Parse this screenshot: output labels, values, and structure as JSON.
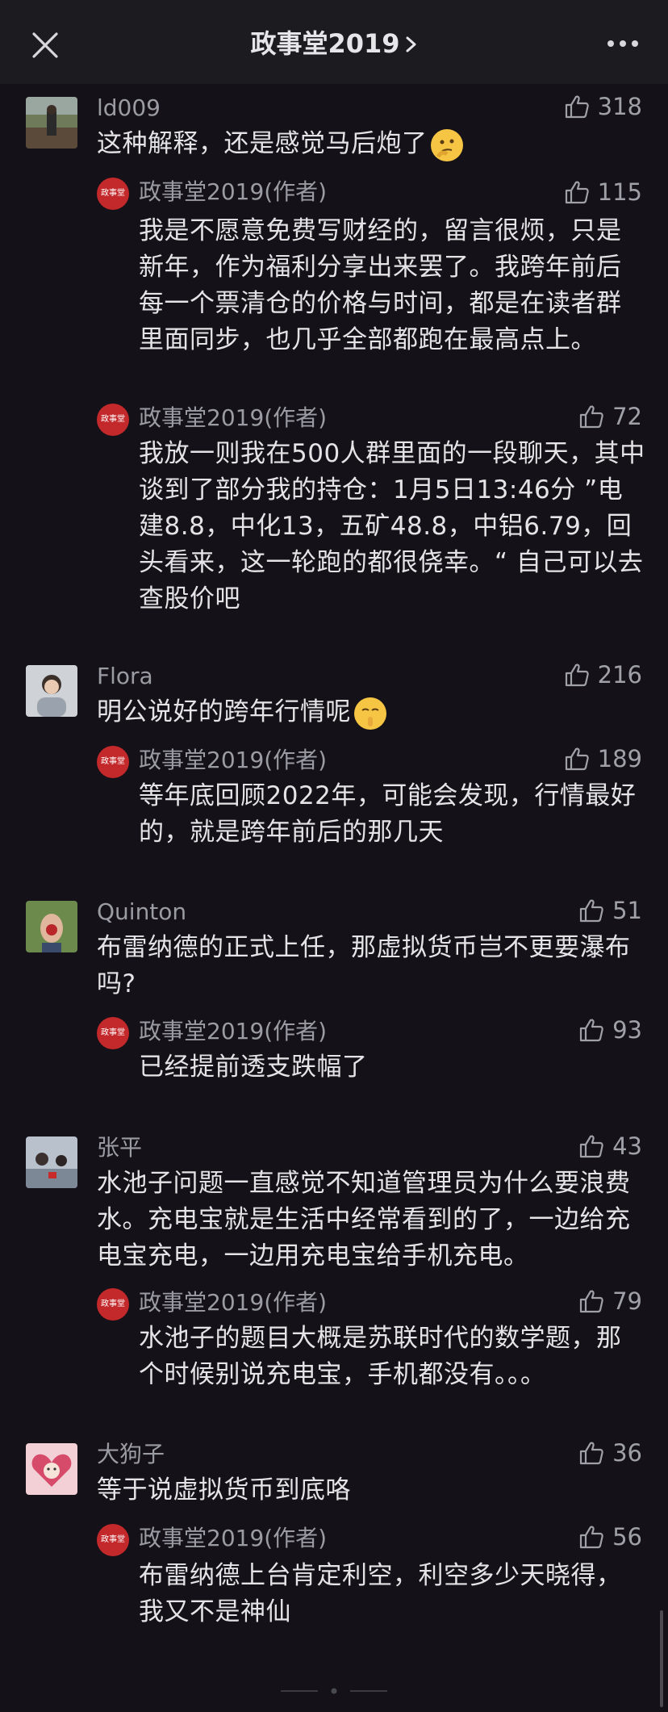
{
  "header": {
    "title": "政事堂2019",
    "close_icon": "close-icon",
    "more_icon": "more-icon"
  },
  "comments": [
    {
      "user": "ld009",
      "likes": "318",
      "text": "这种解释，还是感觉马后炮了",
      "emoji": "thinking-face-emoji",
      "replies": [
        {
          "user": "政事堂2019(作者)",
          "likes": "115",
          "text": "我是不愿意免费写财经的，留言很烦，只是新年，作为福利分享出来罢了。我跨年前后每一个票清仓的价格与时间，都是在读者群里面同步，也几乎全部都跑在最高点上。"
        },
        {
          "user": "政事堂2019(作者)",
          "likes": "72",
          "text": "我放一则我在500人群里面的一段聊天，其中谈到了部分我的持仓：1月5日13:46分 ”电建8.8，中化13，五矿48.8，中铝6.79，回头看来，这一轮跑的都很侥幸。“ 自己可以去查股价吧"
        }
      ]
    },
    {
      "user": "Flora",
      "likes": "216",
      "text": "明公说好的跨年行情呢",
      "emoji": "shushing-face-emoji",
      "replies": [
        {
          "user": "政事堂2019(作者)",
          "likes": "189",
          "text": "等年底回顾2022年，可能会发现，行情最好的，就是跨年前后的那几天"
        }
      ]
    },
    {
      "user": "Quinton",
      "likes": "51",
      "text": "布雷纳德的正式上任，那虚拟货币岂不更要瀑布吗?",
      "replies": [
        {
          "user": "政事堂2019(作者)",
          "likes": "93",
          "text": "已经提前透支跌幅了"
        }
      ]
    },
    {
      "user": "张平",
      "likes": "43",
      "text": "水池子问题一直感觉不知道管理员为什么要浪费水。充电宝就是生活中经常看到的了，一边给充电宝充电，一边用充电宝给手机充电。",
      "replies": [
        {
          "user": "政事堂2019(作者)",
          "likes": "79",
          "text": "水池子的题目大概是苏联时代的数学题，那个时候别说充电宝，手机都没有。。。"
        }
      ]
    },
    {
      "user": "大狗子",
      "likes": "36",
      "text": "等于说虚拟货币到底咯",
      "replies": [
        {
          "user": "政事堂2019(作者)",
          "likes": "56",
          "text": "布雷纳德上台肯定利空，利空多少天晓得，我又不是神仙"
        }
      ]
    }
  ],
  "author_avatar_text": "政事堂"
}
